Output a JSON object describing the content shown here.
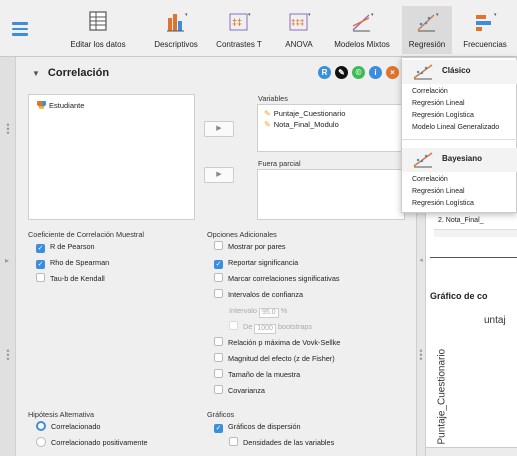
{
  "toolbar": {
    "items": [
      {
        "label": "Editar los datos"
      },
      {
        "label": "Descriptivos"
      },
      {
        "label": "Contrastes T"
      },
      {
        "label": "ANOVA"
      },
      {
        "label": "Modelos Mixtos"
      },
      {
        "label": "Regresión"
      },
      {
        "label": "Frecuencias"
      }
    ]
  },
  "panel": {
    "title": "Correlación",
    "source_vars": [
      "Estudiante"
    ],
    "variables_label": "Variables",
    "variables": [
      "Puntaje_Cuestionario",
      "Nota_Final_Modulo"
    ],
    "partial_label": "Fuera parcial",
    "coef_section": "Coeficiente de Correlación Muestral",
    "coef": [
      {
        "label": "R de Pearson",
        "checked": true
      },
      {
        "label": "Rho de Spearman",
        "checked": true
      },
      {
        "label": "Tau-b de Kendall",
        "checked": false
      }
    ],
    "additional_section": "Opciones Adicionales",
    "additional": [
      {
        "label": "Mostrar por pares",
        "checked": false
      },
      {
        "label": "Reportar significancia",
        "checked": true
      },
      {
        "label": "Marcar correlaciones significativas",
        "checked": false
      },
      {
        "label": "Intervalos de confianza",
        "checked": false
      }
    ],
    "interval_label": "Intervalo",
    "interval_value": "95.0",
    "interval_unit": "%",
    "de_label": "De",
    "de_value": "1000",
    "bootstraps_label": "bootstraps",
    "additional2": [
      {
        "label": "Relación p máxima de Vovk-Sellke",
        "checked": false
      },
      {
        "label": "Magnitud del efecto (z de Fisher)",
        "checked": false
      },
      {
        "label": "Tamaño de la muestra",
        "checked": false
      },
      {
        "label": "Covarianza",
        "checked": false
      }
    ],
    "hyp_section": "Hipótesis Alternativa",
    "hyp": [
      {
        "label": "Correlacionado",
        "selected": true
      },
      {
        "label": "Correlacionado positivamente",
        "selected": false
      }
    ],
    "graphs_section": "Gráficos",
    "graphs": [
      {
        "label": "Gráficos de dispersión",
        "checked": true
      },
      {
        "label": "Densidades de las variables",
        "checked": false
      }
    ]
  },
  "dropdown": {
    "classic_header": "Clásico",
    "classic_items": [
      "Correlación",
      "Regresión Lineal",
      "Regresión Logística",
      "Modelo Lineal Generalizado"
    ],
    "bayes_header": "Bayesiano",
    "bayes_items": [
      "Correlación",
      "Regresión Lineal",
      "Regresión Logística"
    ]
  },
  "output": {
    "row_text": "2. Nota_Final_",
    "graph_title": "Gráfico de co",
    "plot_label": "untaj",
    "yaxis_label": "Puntaje_Cuestionario"
  },
  "colors": {
    "accent": "#3b8edb",
    "pencil": "#f0a020"
  }
}
